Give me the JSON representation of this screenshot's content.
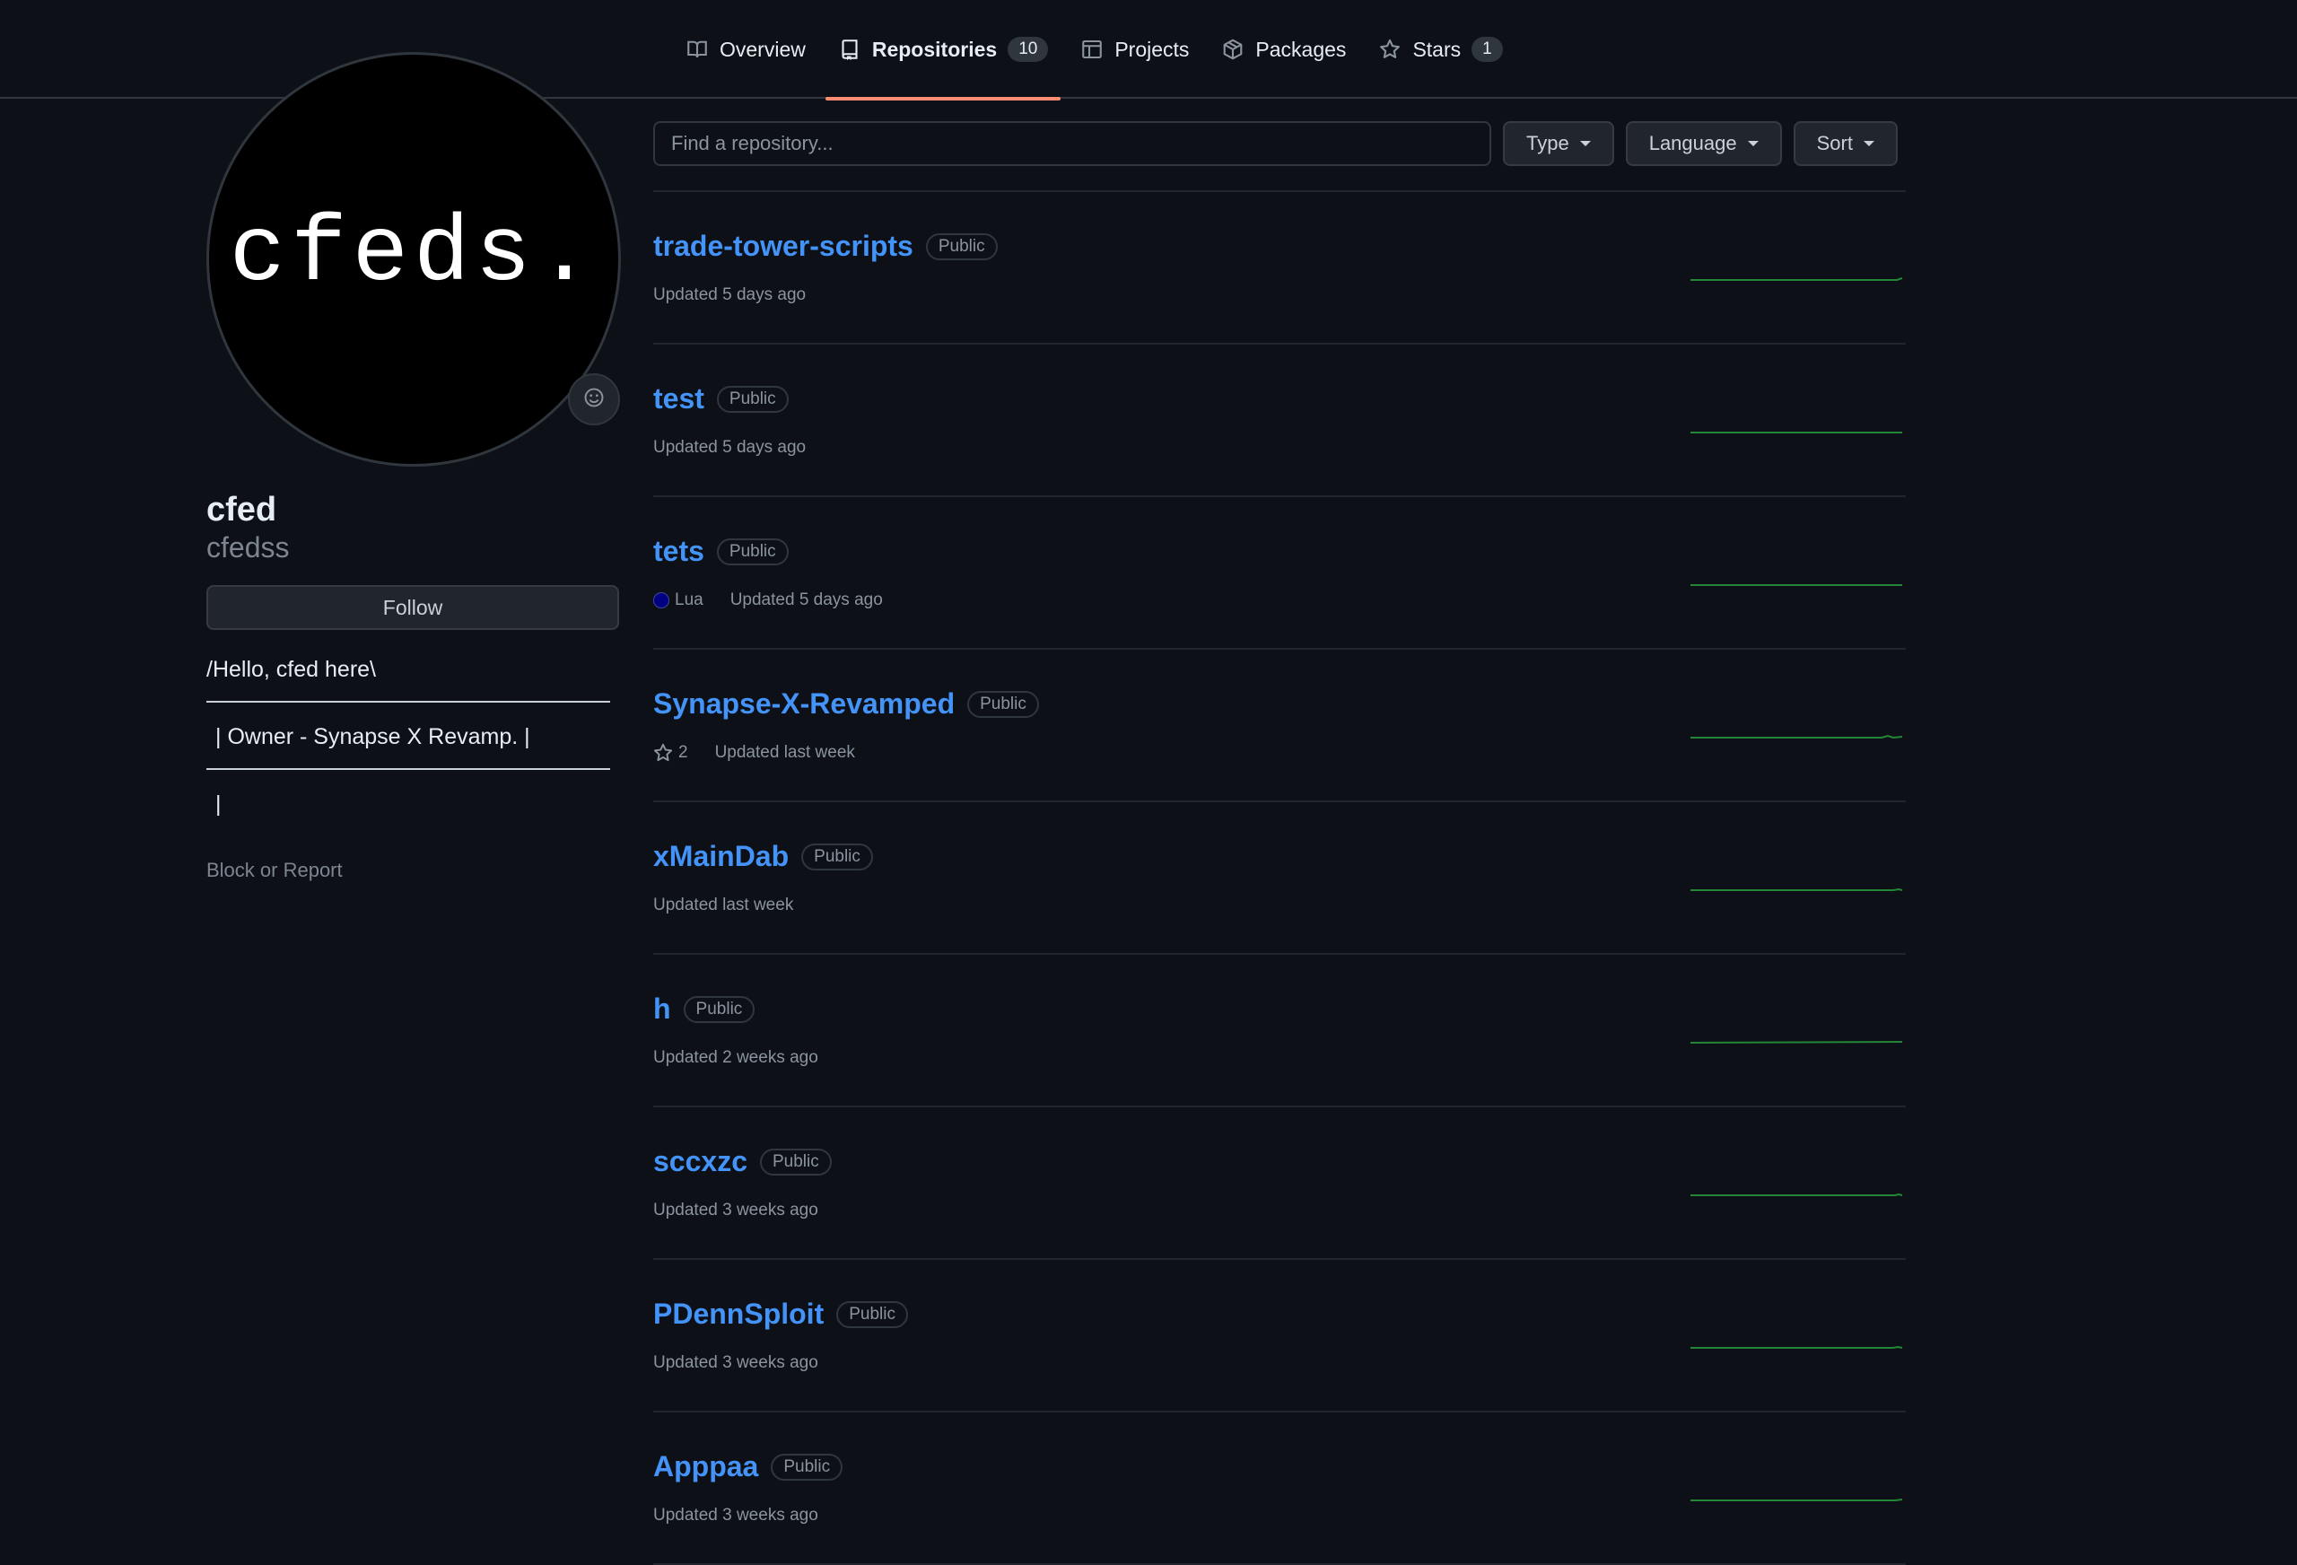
{
  "nav": {
    "tabs": [
      {
        "label": "Overview",
        "icon": "book-icon"
      },
      {
        "label": "Repositories",
        "count": "10",
        "icon": "repo-icon",
        "active": true
      },
      {
        "label": "Projects",
        "icon": "table-icon"
      },
      {
        "label": "Packages",
        "icon": "package-icon"
      },
      {
        "label": "Stars",
        "count": "1",
        "icon": "star-icon"
      }
    ],
    "active_color": "#fd8c73"
  },
  "profile": {
    "avatar_text": "cfeds.",
    "emoji_icon": "smiley-icon",
    "name": "cfed",
    "username": "cfedss",
    "follow_label": "Follow",
    "bio": {
      "line1": "/Hello, cfed here\\",
      "line2": "|  Owner - Synapse X Revamp.  |",
      "line3": "|"
    },
    "block_label": "Block or Report"
  },
  "filters": {
    "search_placeholder": "Find a repository...",
    "type_label": "Type",
    "language_label": "Language",
    "sort_label": "Sort"
  },
  "repos": [
    {
      "name": "trade-tower-scripts",
      "visibility": "Public",
      "updated": "Updated 5 days ago"
    },
    {
      "name": "test",
      "visibility": "Public",
      "updated": "Updated 5 days ago"
    },
    {
      "name": "tets",
      "visibility": "Public",
      "language": "Lua",
      "language_color": "#000080",
      "updated": "Updated 5 days ago"
    },
    {
      "name": "Synapse-X-Revamped",
      "visibility": "Public",
      "stars": "2",
      "updated": "Updated last week"
    },
    {
      "name": "xMainDab",
      "visibility": "Public",
      "updated": "Updated last week"
    },
    {
      "name": "h",
      "visibility": "Public",
      "updated": "Updated 2 weeks ago"
    },
    {
      "name": "sccxzc",
      "visibility": "Public",
      "updated": "Updated 3 weeks ago"
    },
    {
      "name": "PDennSploit",
      "visibility": "Public",
      "updated": "Updated 3 weeks ago"
    },
    {
      "name": "Apppaa",
      "visibility": "Public",
      "updated": "Updated 3 weeks ago"
    }
  ],
  "colors": {
    "link": "#4493f8",
    "sparkline": "#238636",
    "background": "#0d1117"
  }
}
